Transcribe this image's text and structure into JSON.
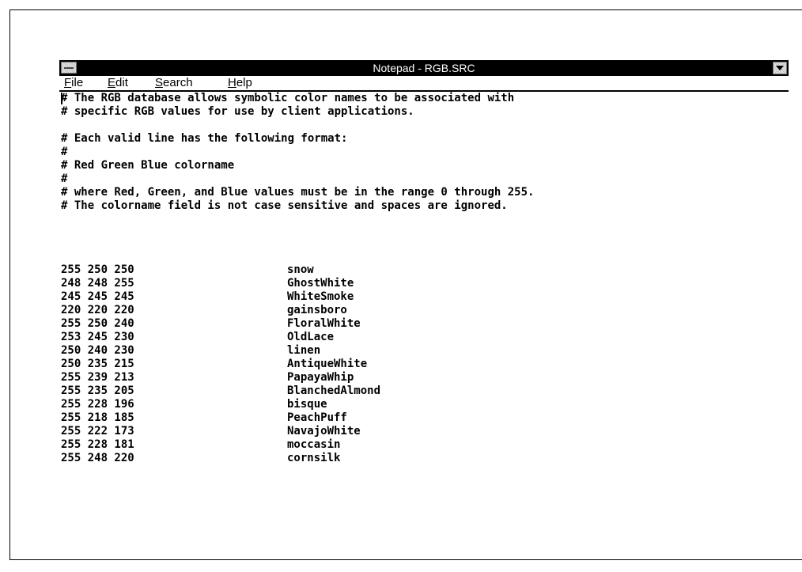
{
  "window": {
    "title": "Notepad - RGB.SRC"
  },
  "icons": {
    "system_menu": "system-menu-icon",
    "minimize": "minimize-arrow-icon"
  },
  "menu": [
    {
      "mnemonic": "F",
      "rest": "ile"
    },
    {
      "mnemonic": "E",
      "rest": "dit"
    },
    {
      "mnemonic": "S",
      "rest": "earch"
    },
    {
      "mnemonic": "H",
      "rest": "elp"
    }
  ],
  "comments": [
    "# The RGB database allows symbolic color names to be associated with",
    "# specific RGB values for use by client applications.",
    "# Each valid line has the following format:",
    "#",
    "# Red Green Blue colorname",
    "#",
    "# where Red, Green, and Blue values must be in the range 0 through 255.",
    "# The colorname field is not case sensitive and spaces are ignored."
  ],
  "colors": [
    {
      "rgb": "255 250 250",
      "name": "snow"
    },
    {
      "rgb": "248 248 255",
      "name": "GhostWhite"
    },
    {
      "rgb": "245 245 245",
      "name": "WhiteSmoke"
    },
    {
      "rgb": "220 220 220",
      "name": "gainsboro"
    },
    {
      "rgb": "255 250 240",
      "name": "FloralWhite"
    },
    {
      "rgb": "253 245 230",
      "name": "OldLace"
    },
    {
      "rgb": "250 240 230",
      "name": "linen"
    },
    {
      "rgb": "250 235 215",
      "name": "AntiqueWhite"
    },
    {
      "rgb": "255 239 213",
      "name": "PapayaWhip"
    },
    {
      "rgb": "255 235 205",
      "name": "BlanchedAlmond"
    },
    {
      "rgb": "255 228 196",
      "name": "bisque"
    },
    {
      "rgb": "255 218 185",
      "name": "PeachPuff"
    },
    {
      "rgb": "255 222 173",
      "name": "NavajoWhite"
    },
    {
      "rgb": "255 228 181",
      "name": "moccasin"
    },
    {
      "rgb": "255 248 220",
      "name": "cornsilk"
    }
  ]
}
